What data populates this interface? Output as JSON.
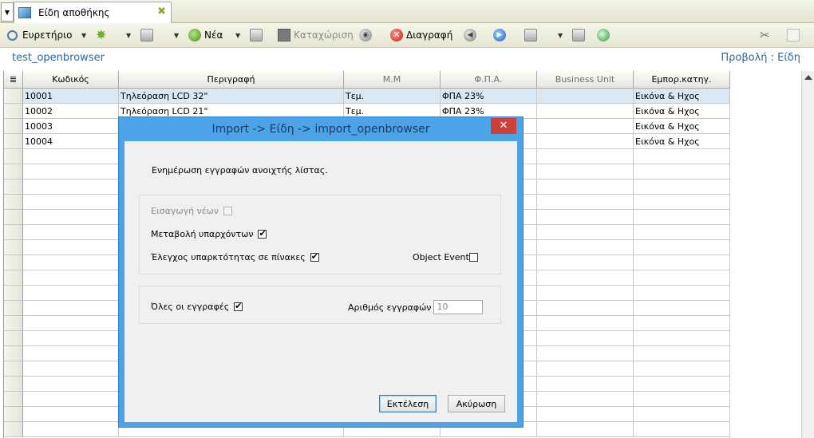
{
  "tab": {
    "title": "Είδη αποθήκης"
  },
  "toolbar": {
    "search_label": "Ευρετήριο",
    "new_label": "Νέα",
    "save_label": "Καταχώριση",
    "delete_label": "Διαγραφή"
  },
  "subheader": {
    "left": "test_openbrowser",
    "right": "Προβολή : Είδη"
  },
  "table": {
    "columns": [
      "Κωδικός",
      "Περιγραφή",
      "Μ.Μ",
      "Φ.Π.Α.",
      "Business Unit",
      "Εμπορ.κατηγ."
    ],
    "rows": [
      [
        "10001",
        "Τηλεόραση LCD 32\"",
        "Τεμ.",
        "ΦΠΑ 23%",
        "",
        "Εικόνα & Ηχος"
      ],
      [
        "10002",
        "Τηλεόραση LCD 21\"",
        "Τεμ.",
        "ΦΠΑ 23%",
        "",
        "Εικόνα & Ηχος"
      ],
      [
        "10003",
        "",
        "",
        "",
        "",
        "Εικόνα & Ηχος"
      ],
      [
        "10004",
        "",
        "",
        "",
        "",
        "Εικόνα & Ηχος"
      ]
    ]
  },
  "dialog": {
    "title": "Import -> Είδη -> import_openbrowser",
    "close_glyph": "✕",
    "message": "Ενημέρωση εγγραφών ανοιχτής λίστας.",
    "insert_new": {
      "label": "Εισαγωγή νέων",
      "checked": false,
      "enabled": false
    },
    "modify_existing": {
      "label": "Μεταβολή υπαρχόντων",
      "checked": true
    },
    "check_existence": {
      "label": "Έλεγχος υπαρκτότητας σε πίνακες",
      "checked": true
    },
    "object_events": {
      "label": "Object Events",
      "checked": false
    },
    "all_records": {
      "label": "Όλες οι εγγραφές",
      "checked": true
    },
    "record_count": {
      "label": "Αριθμός εγγραφών",
      "value": "10"
    },
    "execute_label": "Εκτέλεση",
    "cancel_label": "Ακύρωση"
  }
}
